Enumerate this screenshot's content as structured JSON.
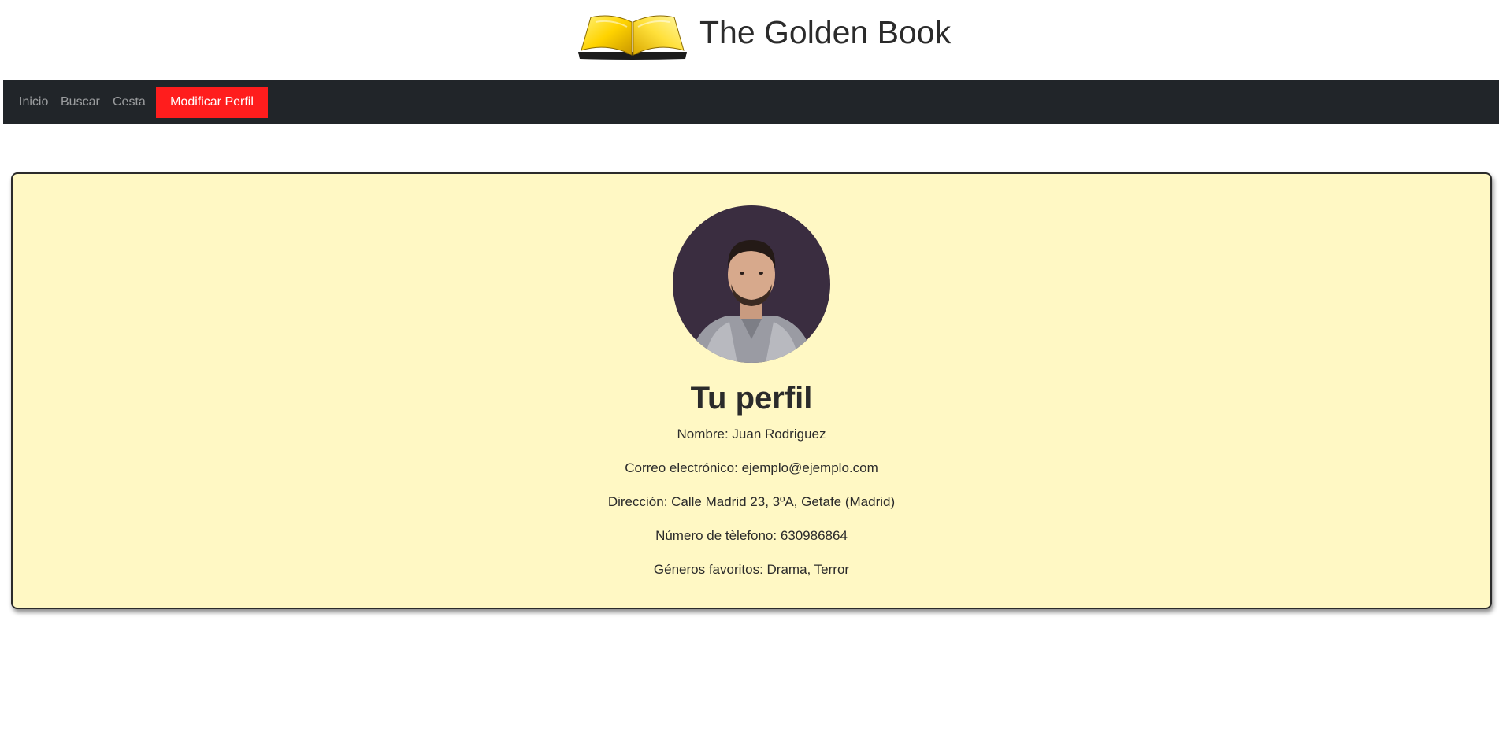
{
  "header": {
    "site_title": "The Golden Book",
    "logo_icon": "open-book-icon"
  },
  "nav": {
    "items": [
      {
        "label": "Inicio"
      },
      {
        "label": "Buscar"
      },
      {
        "label": "Cesta"
      }
    ],
    "active_label": "Modificar Perfil",
    "colors": {
      "background": "#212529",
      "active": "#ff1d1d"
    }
  },
  "profile": {
    "title": "Tu perfil",
    "fields": [
      {
        "text": "Nombre: Juan Rodriguez"
      },
      {
        "text": "Correo electrónico: ejemplo@ejemplo.com"
      },
      {
        "text": "Dirección: Calle Madrid 23, 3ºA, Getafe (Madrid)"
      },
      {
        "text": "Número de tèlefono: 630986864"
      },
      {
        "text": "Géneros favoritos: Drama, Terror"
      }
    ],
    "colors": {
      "card_background": "#fff8c4"
    }
  }
}
